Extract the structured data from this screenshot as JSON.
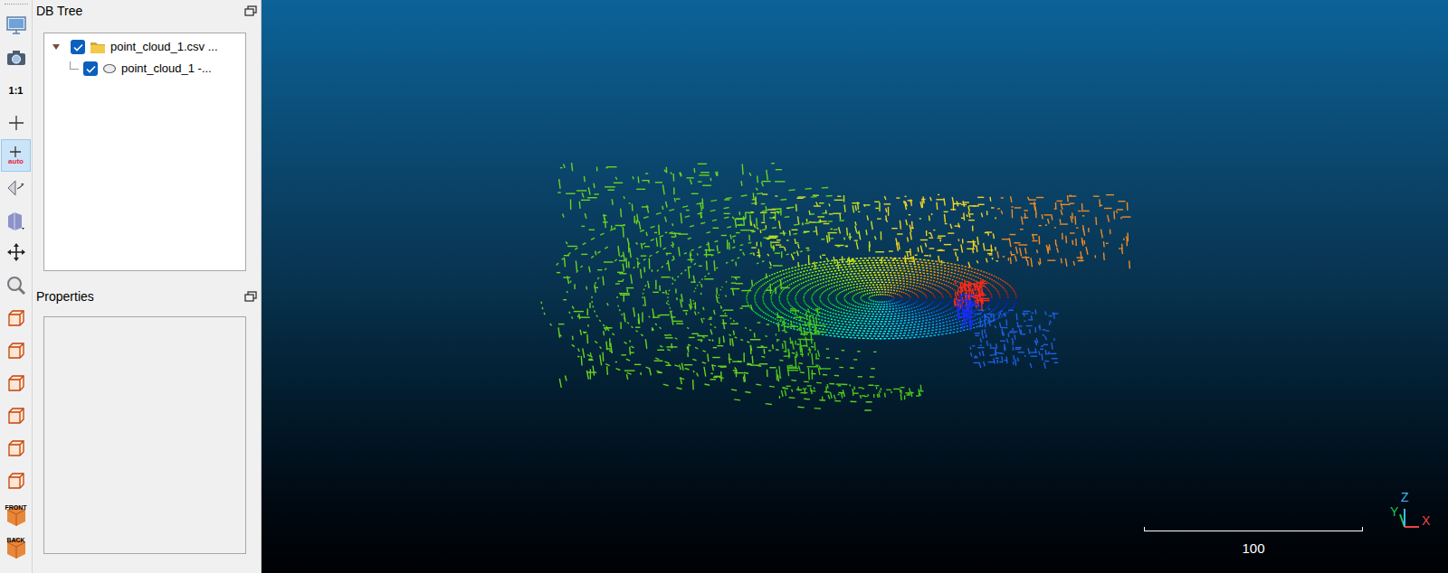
{
  "toolbar": [
    {
      "kind": "display",
      "selected": false
    },
    {
      "kind": "camera",
      "selected": false
    },
    {
      "kind": "text",
      "label": "1:1",
      "selected": false
    },
    {
      "kind": "crosshair",
      "selected": false
    },
    {
      "kind": "auto",
      "label": "auto",
      "selected": true
    },
    {
      "kind": "rotate",
      "selected": false
    },
    {
      "kind": "cube",
      "selected": false
    },
    {
      "kind": "move",
      "selected": false
    },
    {
      "kind": "zoom",
      "selected": false
    },
    {
      "kind": "box",
      "selected": false
    },
    {
      "kind": "box",
      "selected": false
    },
    {
      "kind": "box",
      "selected": false
    },
    {
      "kind": "box",
      "selected": false
    },
    {
      "kind": "box",
      "selected": false
    },
    {
      "kind": "box",
      "selected": false
    },
    {
      "kind": "front",
      "label": "FRONT",
      "selected": false
    },
    {
      "kind": "back",
      "label": "BACK",
      "selected": false
    }
  ],
  "db_tree": {
    "title": "DB Tree",
    "items": [
      {
        "kind": "folder",
        "label": "point_cloud_1.csv ...",
        "checked": true,
        "expanded": true
      },
      {
        "kind": "cloud",
        "label": "point_cloud_1 -...",
        "checked": true
      }
    ]
  },
  "properties": {
    "title": "Properties"
  },
  "view": {
    "scale_bar": {
      "label": "100"
    },
    "axes": [
      {
        "label": "Y",
        "color": "#22c55e"
      },
      {
        "label": "Z",
        "color": "#38bdf8"
      },
      {
        "label": "X",
        "color": "#ef4444"
      }
    ]
  }
}
